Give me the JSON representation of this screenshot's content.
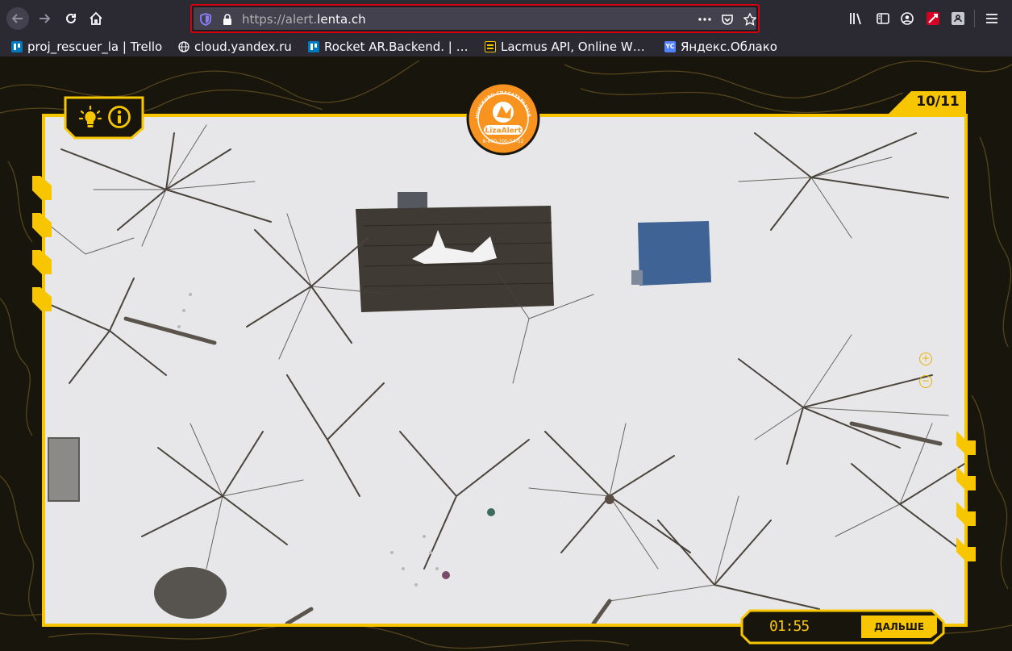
{
  "browser": {
    "url_protocol": "https://alert.",
    "url_domain": "lenta.ch",
    "bookmarks": [
      {
        "label": "proj_rescuer_la | Trello",
        "icon": "trello-icon",
        "color": "#0079bf"
      },
      {
        "label": "cloud.yandex.ru",
        "icon": "globe-icon",
        "color": "#fbfbfe"
      },
      {
        "label": "Rocket AR.Backend. | …",
        "icon": "trello-icon",
        "color": "#0079bf"
      },
      {
        "label": "Lacmus API, Online W…",
        "icon": "lacmus-icon",
        "color": "#f5c400"
      },
      {
        "label": "Яндекс.Облако",
        "icon": "yandex-cloud-icon",
        "color": "#5282ff"
      }
    ]
  },
  "game": {
    "counter": "10/11",
    "timer": "01:55",
    "next_label": "ДАЛЬШЕ",
    "logo": {
      "top_text": "ПОИСКОВО-СПАСАТЕЛЬНЫЙ ОТРЯД",
      "brand": "LizaAlert",
      "phone": "8-800-700-54-52"
    },
    "accent_color": "#f7c600",
    "zoom_in": "+",
    "zoom_out": "−"
  }
}
